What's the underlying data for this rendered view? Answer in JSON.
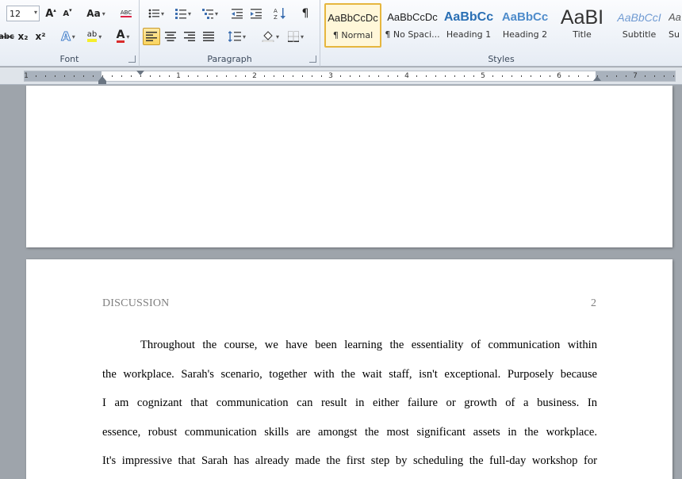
{
  "ribbon": {
    "font_group": {
      "label": "Font",
      "font_size": "12",
      "grow_label": "A",
      "shrink_label": "A",
      "change_case_label": "Aa",
      "clear_format_label": "ABC",
      "strike_label": "abc",
      "subscript_label": "x₂",
      "superscript_label": "x²",
      "text_effects_label": "A",
      "highlight_label": "ab",
      "font_color_label": "A"
    },
    "paragraph_group": {
      "label": "Paragraph",
      "pilcrow": "¶"
    },
    "styles_group": {
      "label": "Styles",
      "styles": [
        {
          "sample": "AaBbCcDc",
          "name": "¶ Normal",
          "selected": true
        },
        {
          "sample": "AaBbCcDc",
          "name": "¶ No Spaci...",
          "selected": false
        },
        {
          "sample": "AaBbCc",
          "name": "Heading 1",
          "selected": false
        },
        {
          "sample": "AaBbCc",
          "name": "Heading 2",
          "selected": false
        },
        {
          "sample": "AaBI",
          "name": "Title",
          "selected": false
        },
        {
          "sample": "AaBbCcI",
          "name": "Subtitle",
          "selected": false
        },
        {
          "sample": "AaBbCcDc",
          "name": "Su",
          "selected": false
        }
      ]
    },
    "colors": {
      "highlight": "#f5ee2c",
      "font_color": "#d92b2b",
      "heading_blue": "#2a6fb4",
      "heading2_blue": "#4f8ccb"
    }
  },
  "ruler": {
    "numbers": [
      "1",
      "1",
      "2",
      "3",
      "4",
      "5",
      "6",
      "7"
    ]
  },
  "document": {
    "header_title": "DISCUSSION",
    "page_number": "2",
    "lines": [
      "Throughout the course, we have been learning the essentiality of communication within",
      "the workplace. Sarah's scenario, together with the wait staff, isn't exceptional. Purposely because",
      "I am cognizant that communication can result in either failure or growth of a business. In",
      "essence, robust communication skills are amongst the most significant assets in the workplace.",
      "It's impressive that Sarah has already made the first step by scheduling the full-day workshop for"
    ]
  }
}
